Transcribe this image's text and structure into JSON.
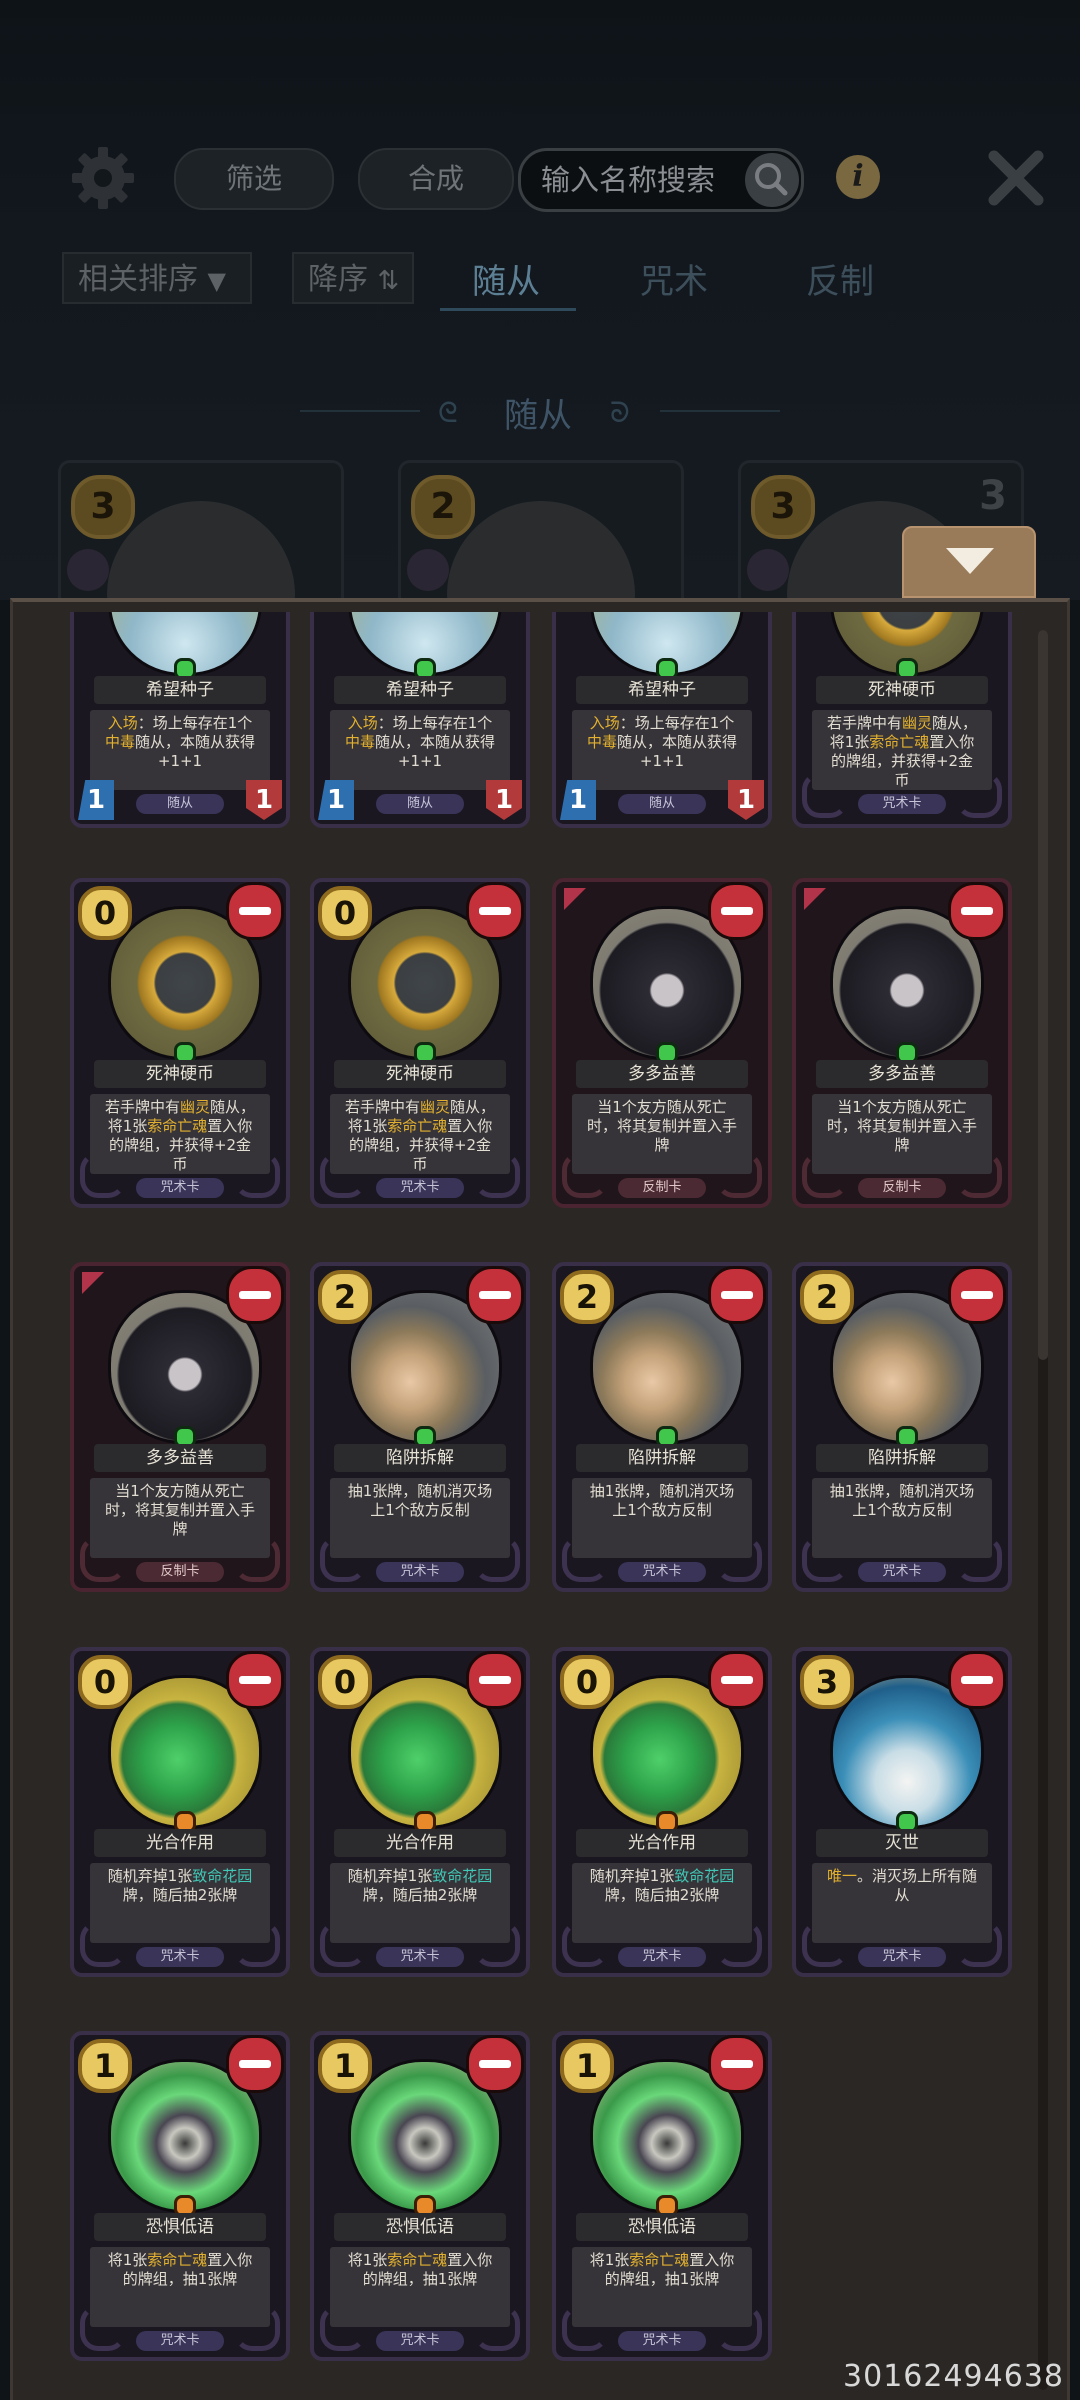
{
  "toolbar": {
    "filter_label": "筛选",
    "compose_label": "合成",
    "search_placeholder": "输入名称搜索",
    "info_label": "i"
  },
  "sort": {
    "sort_label": "相关排序",
    "order_label": "降序"
  },
  "tabs": [
    {
      "label": "随从",
      "active": true
    },
    {
      "label": "咒术",
      "active": false
    },
    {
      "label": "反制",
      "active": false
    }
  ],
  "section_title": "随从",
  "top_row": [
    {
      "cost": "3",
      "right": ""
    },
    {
      "cost": "2",
      "right": ""
    },
    {
      "cost": "3",
      "right": "3"
    }
  ],
  "cards": [
    {
      "name": "希望种子",
      "cost": "",
      "art": "seed",
      "gem": "green",
      "type": "随从",
      "counter": false,
      "atk": "1",
      "hp": "1",
      "desc": [
        {
          "t": "入场",
          "c": "y"
        },
        {
          "t": "：场上每存在1个"
        },
        {
          "br": true
        },
        {
          "t": "中毒",
          "c": "y"
        },
        {
          "t": "随从，本随从获得"
        },
        {
          "br": true
        },
        {
          "t": "+1+1"
        }
      ]
    },
    {
      "name": "希望种子",
      "cost": "",
      "art": "seed",
      "gem": "green",
      "type": "随从",
      "counter": false,
      "atk": "1",
      "hp": "1",
      "desc": [
        {
          "t": "入场",
          "c": "y"
        },
        {
          "t": "：场上每存在1个"
        },
        {
          "br": true
        },
        {
          "t": "中毒",
          "c": "y"
        },
        {
          "t": "随从，本随从获得"
        },
        {
          "br": true
        },
        {
          "t": "+1+1"
        }
      ]
    },
    {
      "name": "希望种子",
      "cost": "",
      "art": "seed",
      "gem": "green",
      "type": "随从",
      "counter": false,
      "atk": "1",
      "hp": "1",
      "desc": [
        {
          "t": "入场",
          "c": "y"
        },
        {
          "t": "：场上每存在1个"
        },
        {
          "br": true
        },
        {
          "t": "中毒",
          "c": "y"
        },
        {
          "t": "随从，本随从获得"
        },
        {
          "br": true
        },
        {
          "t": "+1+1"
        }
      ]
    },
    {
      "name": "死神硬币",
      "cost": "",
      "art": "coin",
      "gem": "green",
      "type": "咒术卡",
      "counter": false,
      "desc": [
        {
          "t": "若手牌中有"
        },
        {
          "t": "幽灵",
          "c": "y"
        },
        {
          "t": "随从，"
        },
        {
          "br": true
        },
        {
          "t": "将1张"
        },
        {
          "t": "索命亡魂",
          "c": "y"
        },
        {
          "t": "置入你"
        },
        {
          "br": true
        },
        {
          "t": "的牌组，并获得+2金"
        },
        {
          "br": true
        },
        {
          "t": "币"
        }
      ]
    },
    {
      "name": "死神硬币",
      "cost": "0",
      "art": "coin",
      "gem": "green",
      "type": "咒术卡",
      "counter": false,
      "desc": [
        {
          "t": "若手牌中有"
        },
        {
          "t": "幽灵",
          "c": "y"
        },
        {
          "t": "随从，"
        },
        {
          "br": true
        },
        {
          "t": "将1张"
        },
        {
          "t": "索命亡魂",
          "c": "y"
        },
        {
          "t": "置入你"
        },
        {
          "br": true
        },
        {
          "t": "的牌组，并获得+2金"
        },
        {
          "br": true
        },
        {
          "t": "币"
        }
      ]
    },
    {
      "name": "死神硬币",
      "cost": "0",
      "art": "coin",
      "gem": "green",
      "type": "咒术卡",
      "counter": false,
      "desc": [
        {
          "t": "若手牌中有"
        },
        {
          "t": "幽灵",
          "c": "y"
        },
        {
          "t": "随从，"
        },
        {
          "br": true
        },
        {
          "t": "将1张"
        },
        {
          "t": "索命亡魂",
          "c": "y"
        },
        {
          "t": "置入你"
        },
        {
          "br": true
        },
        {
          "t": "的牌组，并获得+2金"
        },
        {
          "br": true
        },
        {
          "t": "币"
        }
      ]
    },
    {
      "name": "多多益善",
      "cost": "",
      "art": "hood",
      "gem": "green",
      "type": "反制卡",
      "counter": true,
      "desc": [
        {
          "t": "当1个友方随从死亡"
        },
        {
          "br": true
        },
        {
          "t": "时，将其复制并置入手"
        },
        {
          "br": true
        },
        {
          "t": "牌"
        }
      ]
    },
    {
      "name": "多多益善",
      "cost": "",
      "art": "hood",
      "gem": "green",
      "type": "反制卡",
      "counter": true,
      "desc": [
        {
          "t": "当1个友方随从死亡"
        },
        {
          "br": true
        },
        {
          "t": "时，将其复制并置入手"
        },
        {
          "br": true
        },
        {
          "t": "牌"
        }
      ]
    },
    {
      "name": "多多益善",
      "cost": "",
      "art": "hood",
      "gem": "green",
      "type": "反制卡",
      "counter": true,
      "desc": [
        {
          "t": "当1个友方随从死亡"
        },
        {
          "br": true
        },
        {
          "t": "时，将其复制并置入手"
        },
        {
          "br": true
        },
        {
          "t": "牌"
        }
      ]
    },
    {
      "name": "陷阱拆解",
      "cost": "2",
      "art": "trap",
      "gem": "green",
      "type": "咒术卡",
      "counter": false,
      "desc": [
        {
          "t": "抽1张牌，随机消灭场"
        },
        {
          "br": true
        },
        {
          "t": "上1个敌方反制"
        }
      ]
    },
    {
      "name": "陷阱拆解",
      "cost": "2",
      "art": "trap",
      "gem": "green",
      "type": "咒术卡",
      "counter": false,
      "desc": [
        {
          "t": "抽1张牌，随机消灭场"
        },
        {
          "br": true
        },
        {
          "t": "上1个敌方反制"
        }
      ]
    },
    {
      "name": "陷阱拆解",
      "cost": "2",
      "art": "trap",
      "gem": "green",
      "type": "咒术卡",
      "counter": false,
      "desc": [
        {
          "t": "抽1张牌，随机消灭场"
        },
        {
          "br": true
        },
        {
          "t": "上1个敌方反制"
        }
      ]
    },
    {
      "name": "光合作用",
      "cost": "0",
      "art": "clover",
      "gem": "orange",
      "type": "咒术卡",
      "counter": false,
      "desc": [
        {
          "t": "随机弃掉1张"
        },
        {
          "t": "致命花园",
          "c": "g"
        },
        {
          "br": true
        },
        {
          "t": "牌，随后抽2张牌"
        }
      ]
    },
    {
      "name": "光合作用",
      "cost": "0",
      "art": "clover",
      "gem": "orange",
      "type": "咒术卡",
      "counter": false,
      "desc": [
        {
          "t": "随机弃掉1张"
        },
        {
          "t": "致命花园",
          "c": "g"
        },
        {
          "br": true
        },
        {
          "t": "牌，随后抽2张牌"
        }
      ]
    },
    {
      "name": "光合作用",
      "cost": "0",
      "art": "clover",
      "gem": "orange",
      "type": "咒术卡",
      "counter": false,
      "desc": [
        {
          "t": "随机弃掉1张"
        },
        {
          "t": "致命花园",
          "c": "g"
        },
        {
          "br": true
        },
        {
          "t": "牌，随后抽2张牌"
        }
      ]
    },
    {
      "name": "灭世",
      "cost": "3",
      "art": "wave",
      "gem": "red",
      "type": "咒术卡",
      "counter": false,
      "desc": [
        {
          "t": "唯一",
          "c": "y"
        },
        {
          "t": "。消灭场上所有随"
        },
        {
          "br": true
        },
        {
          "t": "从"
        }
      ]
    },
    {
      "name": "恐惧低语",
      "cost": "1",
      "art": "fear",
      "gem": "orange",
      "type": "咒术卡",
      "counter": false,
      "desc": [
        {
          "t": "将1张"
        },
        {
          "t": "索命亡魂",
          "c": "y"
        },
        {
          "t": "置入你"
        },
        {
          "br": true
        },
        {
          "t": "的牌组，抽1张牌"
        }
      ]
    },
    {
      "name": "恐惧低语",
      "cost": "1",
      "art": "fear",
      "gem": "orange",
      "type": "咒术卡",
      "counter": false,
      "desc": [
        {
          "t": "将1张"
        },
        {
          "t": "索命亡魂",
          "c": "y"
        },
        {
          "t": "置入你"
        },
        {
          "br": true
        },
        {
          "t": "的牌组，抽1张牌"
        }
      ]
    },
    {
      "name": "恐惧低语",
      "cost": "1",
      "art": "fear",
      "gem": "orange",
      "type": "咒术卡",
      "counter": false,
      "desc": [
        {
          "t": "将1张"
        },
        {
          "t": "索命亡魂",
          "c": "y"
        },
        {
          "t": "置入你"
        },
        {
          "br": true
        },
        {
          "t": "的牌组，抽1张牌"
        }
      ]
    }
  ],
  "watermark": "30162494638",
  "colors": {
    "highlight_yellow": "#e3b12f",
    "highlight_green": "#40c7b6",
    "panel": "#2b2724",
    "remove_button": "#c4313a"
  }
}
